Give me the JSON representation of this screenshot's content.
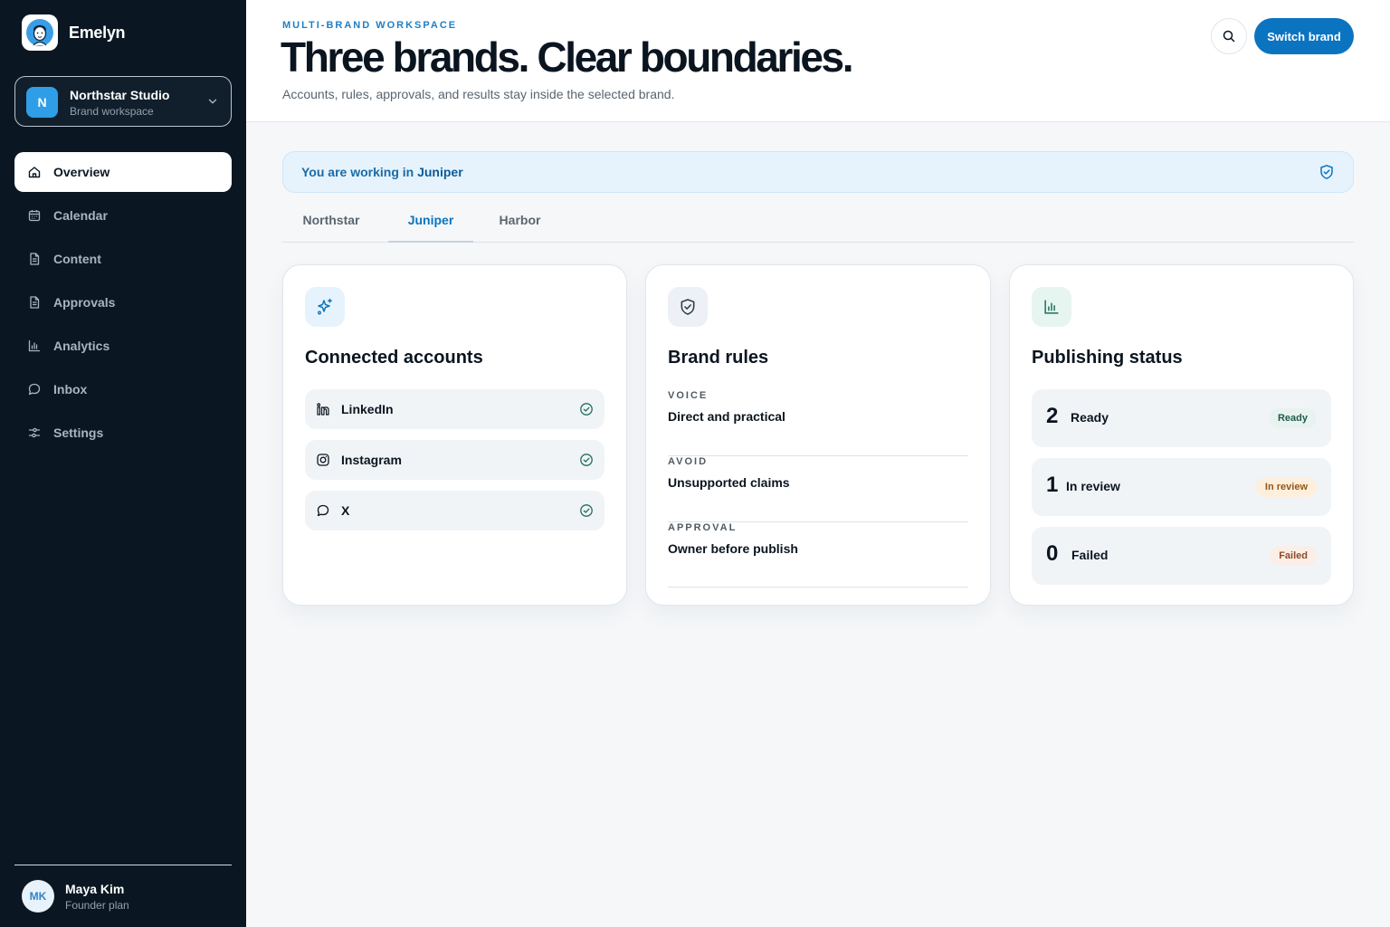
{
  "app": {
    "name": "Emelyn"
  },
  "brand_switcher": {
    "initial": "N",
    "name": "Northstar Studio",
    "subtitle": "Brand workspace"
  },
  "nav": {
    "items": [
      {
        "label": "Overview",
        "icon": "home-icon",
        "active": true
      },
      {
        "label": "Calendar",
        "icon": "calendar-icon"
      },
      {
        "label": "Content",
        "icon": "document-icon"
      },
      {
        "label": "Approvals",
        "icon": "document-icon"
      },
      {
        "label": "Analytics",
        "icon": "bar-chart-icon"
      },
      {
        "label": "Inbox",
        "icon": "chat-bubble-icon"
      },
      {
        "label": "Settings",
        "icon": "sliders-icon"
      }
    ]
  },
  "user": {
    "initials": "MK",
    "name": "Maya Kim",
    "plan": "Founder plan"
  },
  "header": {
    "eyebrow": "MULTI-BRAND WORKSPACE",
    "title": "Three brands. Clear boundaries.",
    "subtitle": "Accounts, rules, approvals, and results stay inside the selected brand.",
    "switch_label": "Switch brand"
  },
  "banner": {
    "prefix": "You are working in",
    "brand": "Juniper"
  },
  "tabs": [
    {
      "label": "Northstar"
    },
    {
      "label": "Juniper",
      "active": true
    },
    {
      "label": "Harbor"
    }
  ],
  "accounts_card": {
    "title": "Connected accounts",
    "items": [
      {
        "label": "LinkedIn",
        "icon": "linkedin-icon"
      },
      {
        "label": "Instagram",
        "icon": "instagram-icon"
      },
      {
        "label": "X",
        "icon": "chat-bubble-icon"
      }
    ]
  },
  "rules_card": {
    "title": "Brand rules",
    "items": [
      {
        "key": "VOICE",
        "value": "Direct and practical"
      },
      {
        "key": "AVOID",
        "value": "Unsupported claims"
      },
      {
        "key": "APPROVAL",
        "value": "Owner before publish"
      }
    ]
  },
  "status_card": {
    "title": "Publishing status",
    "items": [
      {
        "count": "2",
        "label": "Ready",
        "badge": "Ready"
      },
      {
        "count": "1",
        "label": "In review",
        "badge": "In review"
      },
      {
        "count": "0",
        "label": "Failed",
        "badge": "Failed"
      }
    ]
  },
  "colors": {
    "accent": "#0b74c0",
    "sidebar": "#0a1722",
    "page": "#f5f7f9"
  }
}
